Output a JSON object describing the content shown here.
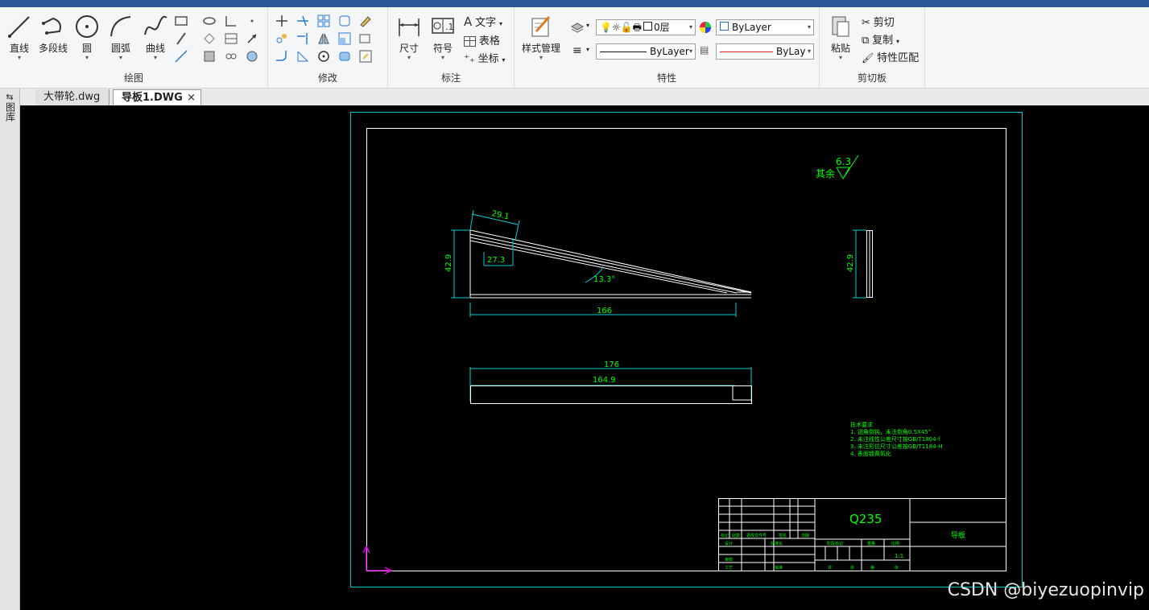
{
  "ribbon": {
    "draw": {
      "label": "绘图",
      "line": "直线",
      "polyline": "多段线",
      "circle": "圆",
      "arc": "圆弧",
      "spline": "曲线"
    },
    "modify": {
      "label": "修改"
    },
    "annotate": {
      "label": "标注",
      "dimension": "尺寸",
      "symbol": "符号",
      "text": "文字",
      "table": "表格",
      "coordinate": "坐标"
    },
    "properties": {
      "label": "特性",
      "style_manager": "样式管理",
      "layer_value": "0层",
      "color_value": "ByLayer",
      "linetype_value": "ByLayer",
      "lineweight_value": "ByLay"
    },
    "clipboard": {
      "label": "剪切板",
      "paste": "粘贴",
      "cut": "剪切",
      "copy": "复制",
      "match": "特性匹配"
    }
  },
  "tabs": [
    {
      "label": "大带轮.dwg",
      "active": false
    },
    {
      "label": "导板1.DWG",
      "active": true,
      "close": "×"
    }
  ],
  "sidebar": {
    "label": "图库"
  },
  "drawing": {
    "roughness_value": "6.3",
    "roughness_prefix": "其余",
    "dims": {
      "top_small": "29.1",
      "left_height": "42.9",
      "inner_width": "27.3",
      "angle": "13.3°",
      "base_length": "166",
      "right_height": "42.9",
      "overall_176": "176",
      "inner_164": "164.9"
    },
    "tech_requirements": [
      "技术要求",
      "1. 锐角倒钝，未注倒角0.5X45°",
      "2. 未注线性公差尺寸按GB/T1804-f",
      "3. 未注形位尺寸公差按GB/T1184-H",
      "4. 表面镀黄氧化"
    ],
    "title_block": {
      "material": "Q235",
      "part_name": "导板",
      "scale": "1:1",
      "headers": [
        "标记",
        "处数",
        "更改文件号",
        "签名",
        "日期"
      ],
      "labels": [
        "设计",
        "标准化",
        "审核",
        "工艺",
        "批准",
        "阶段标记",
        "重量",
        "比例",
        "共",
        "张",
        "第",
        "张"
      ]
    }
  },
  "watermark": "CSDN @biyezuopinvip",
  "colors": {
    "canvas_bg": "#000000",
    "border_cyan": "#00c8c8",
    "geometry_white": "#ffffff",
    "dim_cyan": "#00d0d0",
    "text_green": "#00ff00",
    "ucs_magenta": "#ff00ff",
    "ribbon_bg": "#f5f6f7"
  }
}
